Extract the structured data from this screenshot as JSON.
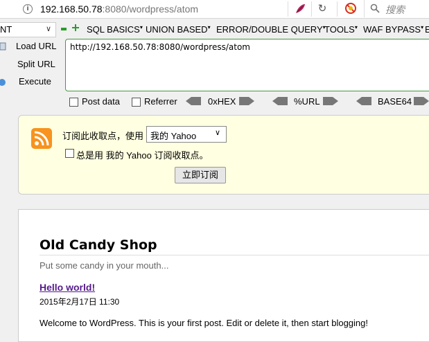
{
  "url_bar": {
    "url_host": "192.168.50.78",
    "url_rest": ":8080/wordpress/atom",
    "search_placeholder": "搜索"
  },
  "hackbar": {
    "select_value": "NT",
    "menus": [
      "SQL BASICS",
      "UNION BASED",
      "ERROR/DOUBLE QUERY",
      "TOOLS",
      "WAF BYPASS",
      "E"
    ],
    "load_url": "Load URL",
    "split_url": "Split URL",
    "execute": "Execute",
    "url_value": "http://192.168.50.78:8080/wordpress/atom",
    "post_data": "Post data",
    "referrer": "Referrer",
    "hex": "0xHEX",
    "url_enc": "%URL",
    "base64": "BASE64"
  },
  "feed": {
    "subscribe_label": "订阅此收取点，使用",
    "reader": "我的 Yahoo",
    "always_label": "总是用 我的 Yahoo 订阅收取点。",
    "subscribe_button": "立即订阅"
  },
  "blog": {
    "site_title": "Old Candy Shop",
    "tagline": "Put some candy in your mouth...",
    "post_title": "Hello world!",
    "post_date": "2015年2月17日 11:30",
    "post_body": "Welcome to WordPress. This is your first post. Edit or delete it, then start blogging!"
  },
  "colors": {
    "accent_green": "#3f9a3f",
    "feed_bg": "#ffffe1",
    "link_purple": "#551a8b",
    "rss_orange": "#f7931e"
  }
}
